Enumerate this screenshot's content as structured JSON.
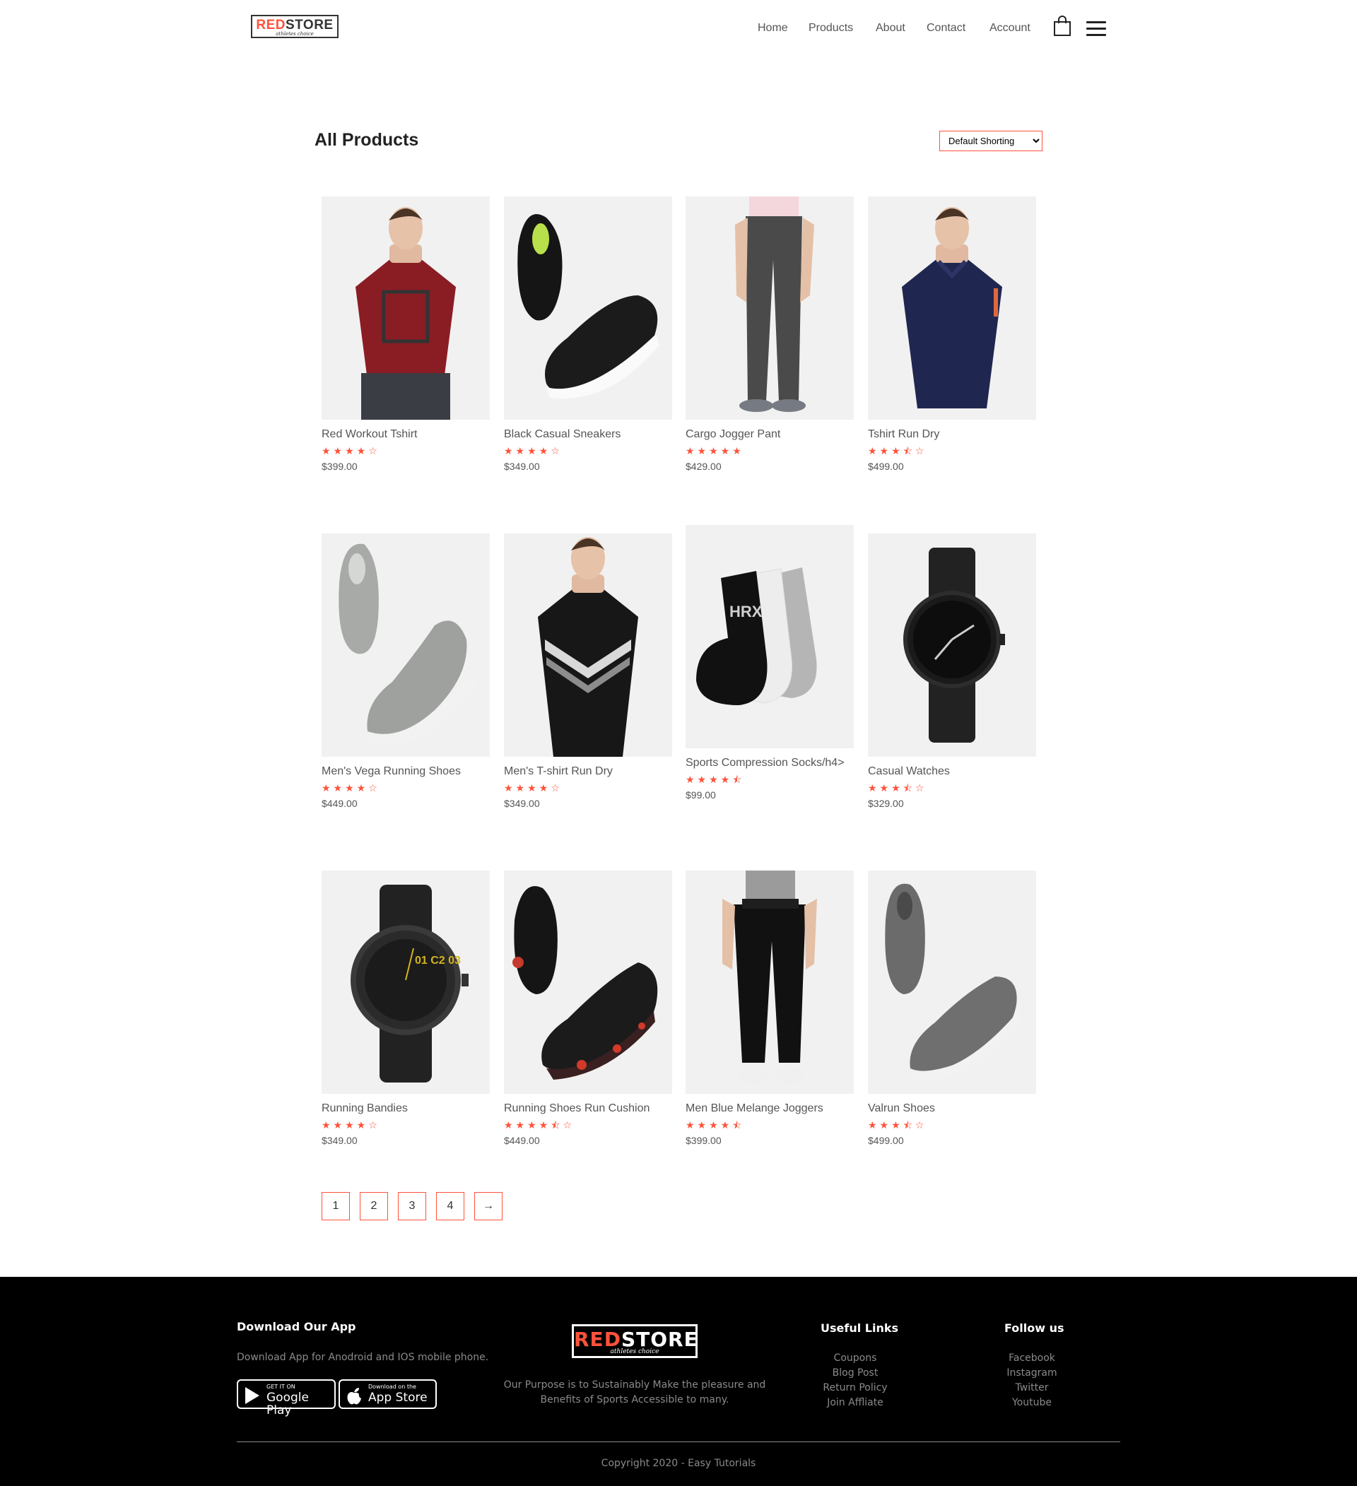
{
  "brand": {
    "red_part": "RED",
    "rest": "STORE",
    "tagline": "athletes choice"
  },
  "nav": {
    "items": [
      "Home",
      "Products",
      "About",
      "Contact",
      "Account"
    ]
  },
  "icons": {
    "cart": "shopping-bag-icon",
    "menu": "hamburger-menu-icon",
    "star": "star-icon"
  },
  "colors": {
    "accent": "#ff523b",
    "footer_bg": "#000000"
  },
  "page": {
    "title": "All Products",
    "sort_selected": "Default Shorting"
  },
  "products": [
    {
      "name": "Red Workout Tshirt",
      "rating": 4,
      "stars": "★★★★☆",
      "price": "$399.00"
    },
    {
      "name": "Black Casual Sneakers",
      "rating": 4,
      "stars": "★★★★☆",
      "price": "$349.00"
    },
    {
      "name": "Cargo Jogger Pant",
      "rating": 5,
      "stars": "★★★★★",
      "price": "$429.00"
    },
    {
      "name": "Tshirt Run Dry",
      "rating": 3.5,
      "stars": "★★★⯪☆",
      "price": "$499.00"
    },
    {
      "name": "Men's Vega Running Shoes",
      "rating": 4,
      "stars": "★★★★☆",
      "price": "$449.00"
    },
    {
      "name": "Men's T-shirt Run Dry",
      "rating": 4,
      "stars": "★★★★☆",
      "price": "$349.00"
    },
    {
      "name": "Sports Compression Socks/h4>",
      "rating": 4.5,
      "stars": "★★★★⯪",
      "price": "$99.00"
    },
    {
      "name": "Casual Watches",
      "rating": 3.5,
      "stars": "★★★⯪☆",
      "price": "$329.00"
    },
    {
      "name": "Running Bandies",
      "rating": 4,
      "stars": "★★★★☆",
      "price": "$349.00"
    },
    {
      "name": "Running Shoes Run Cushion",
      "rating": 4.5,
      "stars": "★★★★⯪☆",
      "price": "$449.00"
    },
    {
      "name": "Men Blue Melange Joggers",
      "rating": 4.5,
      "stars": "★★★★⯪",
      "price": "$399.00"
    },
    {
      "name": "Valrun Shoes",
      "rating": 3.5,
      "stars": "★★★⯪☆",
      "price": "$499.00"
    }
  ],
  "pagination": [
    "1",
    "2",
    "3",
    "4",
    "→"
  ],
  "footer": {
    "app_heading": "Download Our App",
    "app_text": "Download App for Anodroid and IOS mobile phone.",
    "google_small": "GET IT ON",
    "google_big": "Google Play",
    "apple_small": "Download on the",
    "apple_big": "App Store",
    "purpose_line1": "Our Purpose is to Sustainably Make the pleasure and",
    "purpose_line2": "Benefits of Sports Accessible to many.",
    "links_heading": "Useful Links",
    "links": [
      "Coupons",
      "Blog Post",
      "Return Policy",
      "Join Affliate"
    ],
    "follow_heading": "Follow us",
    "follow": [
      "Facebook",
      "Instagram",
      "Twitter",
      "Youtube"
    ],
    "copyright": "Copyright 2020 - Easy Tutorials"
  }
}
